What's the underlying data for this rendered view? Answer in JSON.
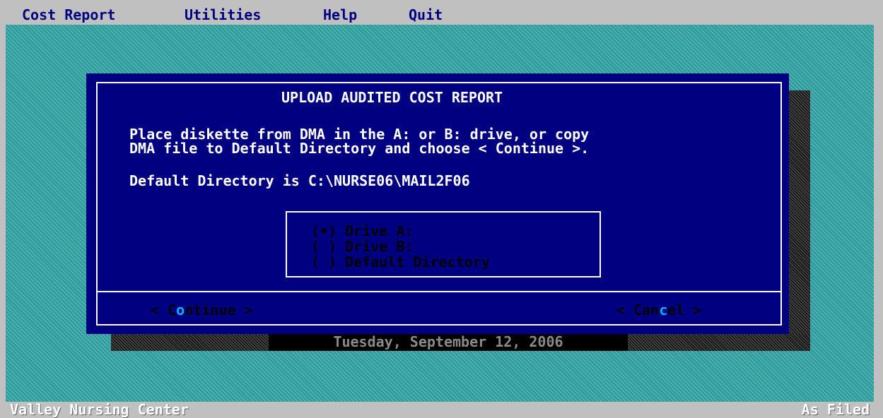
{
  "menu": {
    "items": [
      "Cost Report",
      "Utilities",
      "Help",
      "Quit"
    ]
  },
  "dialog": {
    "title": "UPLOAD AUDITED COST REPORT",
    "instructions": [
      "Place diskette from DMA in the A: or B: drive, or copy",
      "DMA file to Default Directory and choose < Continue >."
    ],
    "default_directory_line": "Default Directory is C:\\NURSE06\\MAIL2F06",
    "options": [
      {
        "marker": "(•)",
        "label": "Drive A:",
        "selected": true
      },
      {
        "marker": "( )",
        "label": "Drive B:",
        "selected": false
      },
      {
        "marker": "( )",
        "label": "Default Directory",
        "selected": false
      }
    ],
    "buttons": {
      "continue": {
        "prefix": "< ",
        "first": "C",
        "hot": "o",
        "rest": "ntinue",
        "suffix": " >"
      },
      "cancel": {
        "prefix": "< ",
        "first": "Can",
        "hot": "c",
        "rest": "el",
        "suffix": " >"
      }
    }
  },
  "date_text": "Tuesday, September 12, 2006",
  "status": {
    "left": "Valley Nursing Center",
    "right": "As Filed"
  },
  "colors": {
    "desktop": "#2e9d9d",
    "dialog_bg": "#000080",
    "hotkey": "#00b0ff",
    "menubar": "#c0c0c0"
  }
}
